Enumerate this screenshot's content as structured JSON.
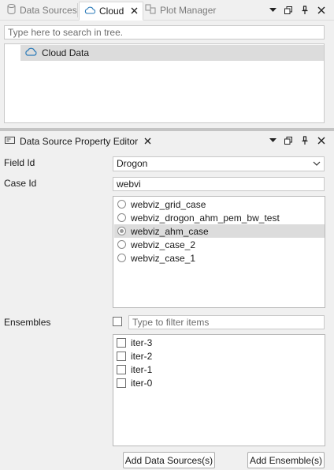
{
  "tabs": [
    {
      "label": "Data Sources",
      "icon": "database-icon"
    },
    {
      "label": "Cloud",
      "icon": "cloud-icon"
    },
    {
      "label": "Plot Manager",
      "icon": "plot-manager-icon"
    }
  ],
  "tree": {
    "search_placeholder": "Type here to search in tree.",
    "items": [
      {
        "label": "Cloud Data",
        "icon": "cloud-icon"
      }
    ]
  },
  "property_editor": {
    "title": "Data Source Property Editor",
    "field_id": {
      "label": "Field Id",
      "value": "Drogon"
    },
    "case_id": {
      "label": "Case Id",
      "filter_value": "webvi",
      "options": [
        "webviz_grid_case",
        "webviz_drogon_ahm_pem_bw_test",
        "webviz_ahm_case",
        "webviz_case_2",
        "webviz_case_1"
      ],
      "selected": "webviz_ahm_case"
    },
    "ensembles": {
      "label": "Ensembles",
      "filter_placeholder": "Type to filter items",
      "items": [
        "iter-3",
        "iter-2",
        "iter-1",
        "iter-0"
      ]
    },
    "buttons": {
      "add_data_sources": "Add Data Sources(s)",
      "add_ensemble": "Add Ensemble(s)"
    }
  },
  "colors": {
    "accent": "#2a7ab8",
    "selection": "#dcdcdc"
  }
}
